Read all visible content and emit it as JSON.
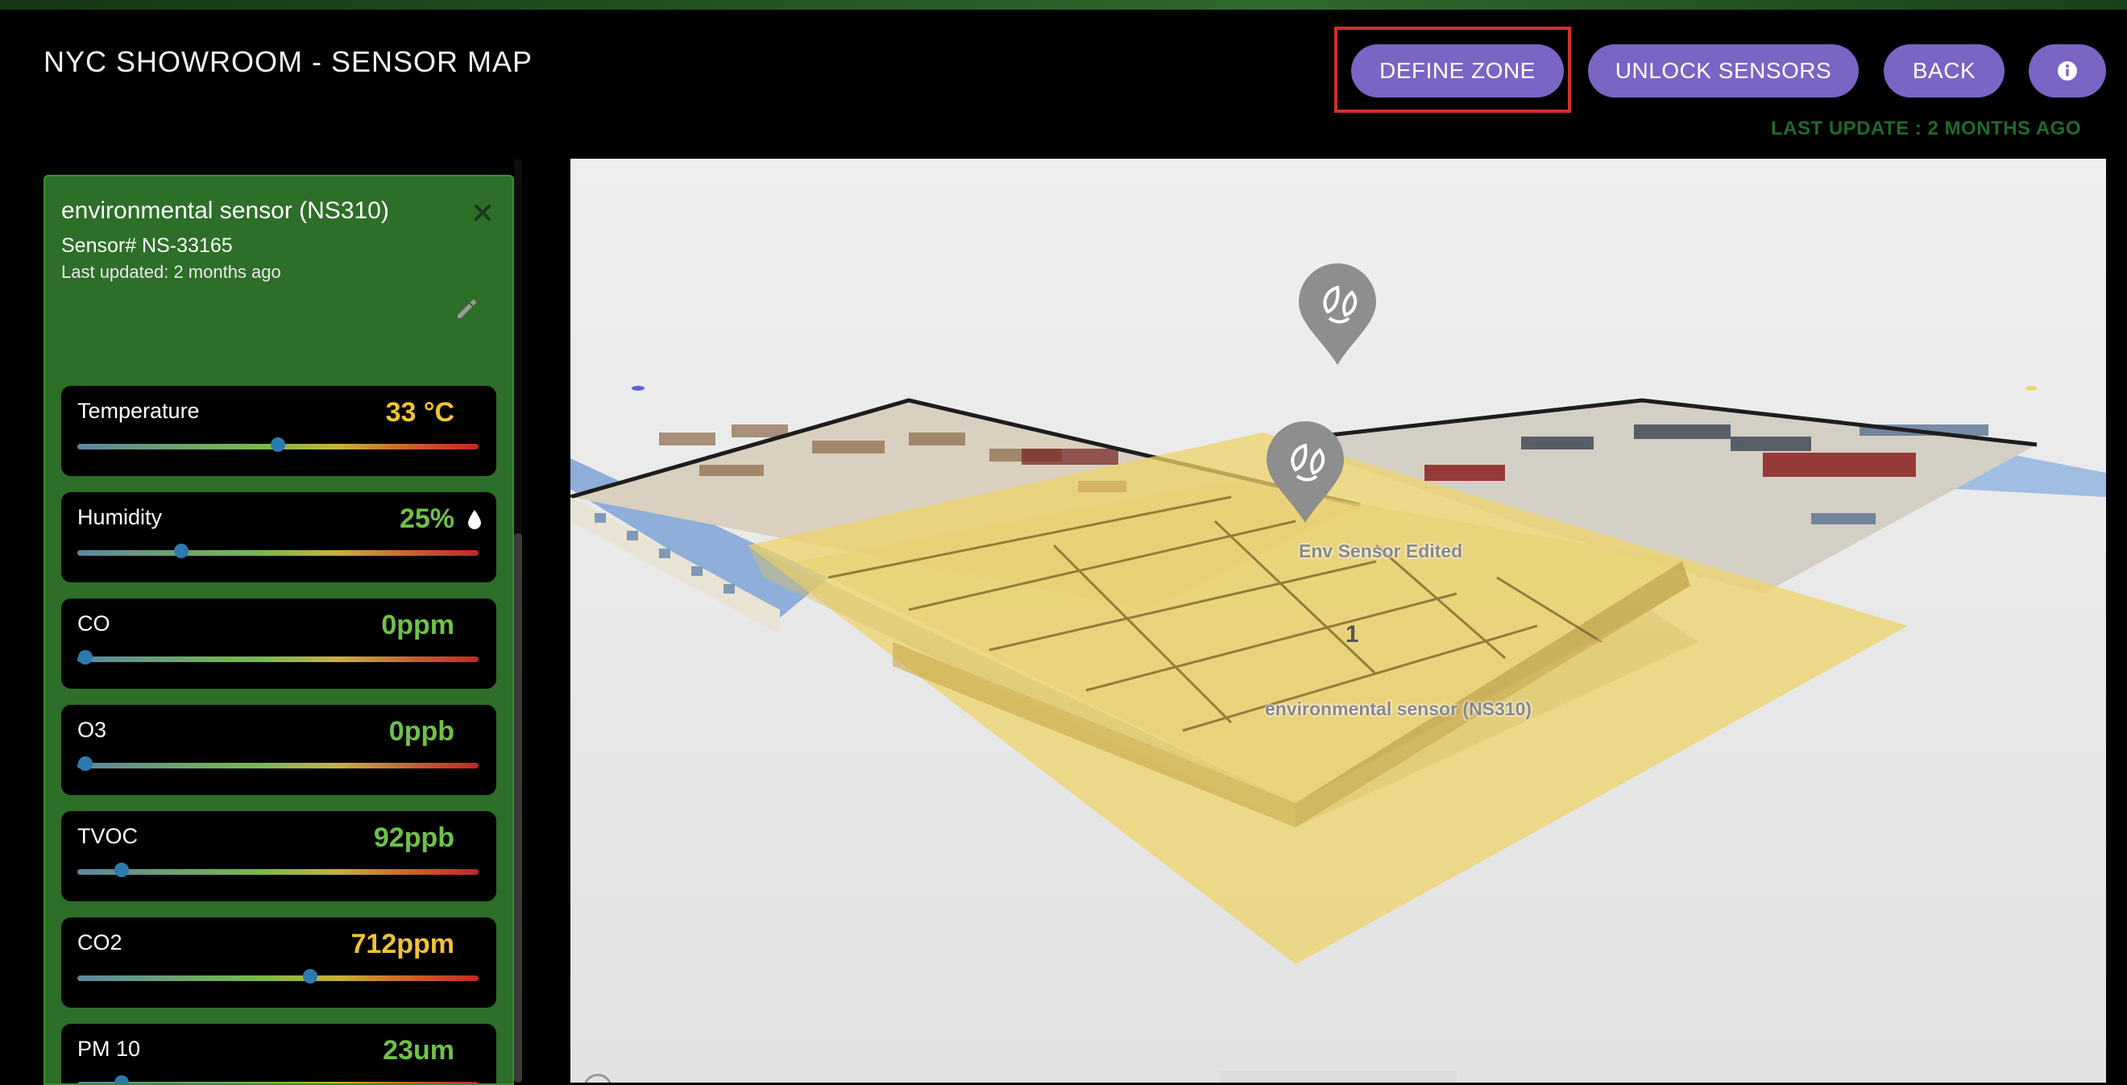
{
  "header": {
    "title": "NYC SHOWROOM - SENSOR MAP",
    "buttons": {
      "define_zone": "DEFINE ZONE",
      "unlock_sensors": "UNLOCK SENSORS",
      "back": "BACK"
    },
    "last_update": "LAST UPDATE : 2 MONTHS AGO"
  },
  "panel": {
    "title": "environmental sensor (NS310)",
    "serial": "Sensor# NS-33165",
    "updated": "Last updated: 2 months ago",
    "readings": [
      {
        "name": "Temperature",
        "value": "33 °C",
        "level": 0.5,
        "color": "#f2c233"
      },
      {
        "name": "Humidity",
        "value": "25%",
        "level": 0.26,
        "color": "#6dc24a"
      },
      {
        "name": "CO",
        "value": "0ppm",
        "level": 0.02,
        "color": "#6dc24a"
      },
      {
        "name": "O3",
        "value": "0ppb",
        "level": 0.02,
        "color": "#6dc24a"
      },
      {
        "name": "TVOC",
        "value": "92ppb",
        "level": 0.11,
        "color": "#6dc24a"
      },
      {
        "name": "CO2",
        "value": "712ppm",
        "level": 0.58,
        "color": "#f2c233"
      },
      {
        "name": "PM 10",
        "value": "23um",
        "level": 0.11,
        "color": "#6dc24a"
      }
    ]
  },
  "map": {
    "pins": [
      {
        "label": "Env Sensor Edited",
        "icon": "leaf-recycle-icon"
      },
      {
        "label": "environmental sensor (NS310)",
        "icon": "leaf-recycle-icon",
        "badge": "1"
      }
    ]
  },
  "colors": {
    "accent_button": "#7a64c4",
    "panel_green": "#2d6e29",
    "highlight": "#d0302a",
    "update_text": "#1f6a2a"
  }
}
